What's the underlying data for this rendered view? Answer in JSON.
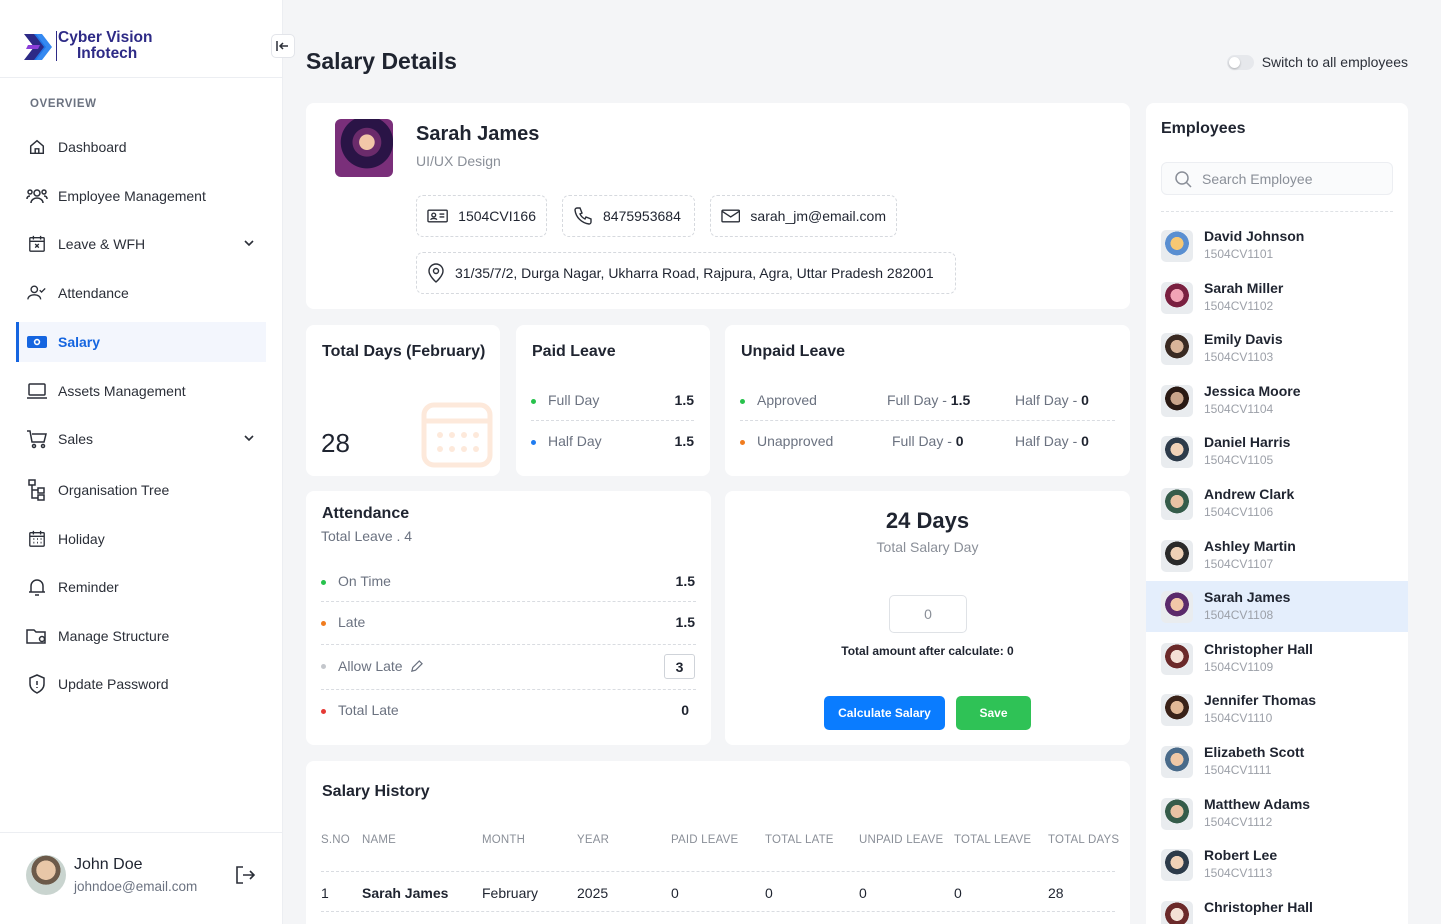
{
  "brand": {
    "line1": "Cyber Vision",
    "line2": "Infotech"
  },
  "sidebar": {
    "section": "OVERVIEW",
    "items": [
      {
        "label": "Dashboard",
        "icon": "home-icon"
      },
      {
        "label": "Employee Management",
        "icon": "users-icon"
      },
      {
        "label": "Leave & WFH",
        "icon": "calendar-x-icon"
      },
      {
        "label": "Attendance",
        "icon": "user-check-icon"
      },
      {
        "label": "Salary",
        "icon": "money-icon"
      },
      {
        "label": "Assets Management",
        "icon": "laptop-icon"
      },
      {
        "label": "Sales",
        "icon": "cart-icon"
      },
      {
        "label": "Organisation Tree",
        "icon": "tree-icon"
      },
      {
        "label": "Holiday",
        "icon": "calendar-icon"
      },
      {
        "label": "Reminder",
        "icon": "bell-icon"
      },
      {
        "label": "Manage Structure",
        "icon": "folder-gear-icon"
      },
      {
        "label": "Update Password",
        "icon": "shield-icon"
      }
    ],
    "active": "Salary"
  },
  "user": {
    "name": "John Doe",
    "email": "johndoe@email.com"
  },
  "header": {
    "title": "Salary Details",
    "switch_label": "Switch to all employees"
  },
  "profile": {
    "name": "Sarah James",
    "role": "UI/UX Design",
    "emp_id": "1504CVI166",
    "phone": "8475953684",
    "email": "sarah_jm@email.com",
    "address": "31/35/7/2, Durga Nagar, Ukharra Road, Rajpura, Agra, Uttar Pradesh 282001"
  },
  "total_days": {
    "title": "Total Days (February)",
    "value": "28"
  },
  "paid_leave": {
    "title": "Paid Leave",
    "full_day_label": "Full Day",
    "full_day": "1.5",
    "half_day_label": "Half Day",
    "half_day": "1.5"
  },
  "unpaid_leave": {
    "title": "Unpaid Leave",
    "approved_label": "Approved",
    "approved_full": "Full Day - ",
    "approved_full_val": "1.5",
    "approved_half": "Half Day - ",
    "approved_half_val": "0",
    "unapproved_label": "Unapproved",
    "unapproved_full": "Full Day - ",
    "unapproved_full_val": "0",
    "unapproved_half": "Half Day - ",
    "unapproved_half_val": "0"
  },
  "attendance": {
    "title": "Attendance",
    "subtitle": "Total Leave . 4",
    "on_time_label": "On Time",
    "on_time": "1.5",
    "late_label": "Late",
    "late": "1.5",
    "allow_late_label": "Allow Late",
    "allow_late": "3",
    "total_late_label": "Total Late",
    "total_late": "0"
  },
  "salary_calc": {
    "days": "24 Days",
    "days_label": "Total Salary Day",
    "input_value": "0",
    "amount_text": "Total amount after calculate: 0",
    "calc_btn": "Calculate Salary",
    "save_btn": "Save"
  },
  "history": {
    "title": "Salary History",
    "columns": [
      "S.NO",
      "NAME",
      "MONTH",
      "YEAR",
      "PAID LEAVE",
      "TOTAL LATE",
      "UNPAID LEAVE",
      "TOTAL LEAVE",
      "TOTAL DAYS"
    ],
    "rows": [
      [
        "1",
        "Sarah James",
        "February",
        "2025",
        "0",
        "0",
        "0",
        "0",
        "28"
      ]
    ]
  },
  "employees": {
    "title": "Employees",
    "search_placeholder": "Search Employee",
    "list": [
      {
        "name": "David Johnson",
        "id": "1504CV1101"
      },
      {
        "name": "Sarah Miller",
        "id": "1504CV1102"
      },
      {
        "name": "Emily Davis",
        "id": "1504CV1103"
      },
      {
        "name": "Jessica Moore",
        "id": "1504CV1104"
      },
      {
        "name": "Daniel Harris",
        "id": "1504CV1105"
      },
      {
        "name": "Andrew Clark",
        "id": "1504CV1106"
      },
      {
        "name": "Ashley Martin",
        "id": "1504CV1107"
      },
      {
        "name": "Sarah James",
        "id": "1504CV1108"
      },
      {
        "name": "Christopher Hall",
        "id": "1504CV1109"
      },
      {
        "name": "Jennifer Thomas",
        "id": "1504CV1110"
      },
      {
        "name": "Elizabeth Scott",
        "id": "1504CV1111"
      },
      {
        "name": "Matthew Adams",
        "id": "1504CV1112"
      },
      {
        "name": "Robert Lee",
        "id": "1504CV1113"
      },
      {
        "name": "Christopher Hall",
        "id": ""
      }
    ],
    "selected": "Sarah James"
  },
  "colors": {
    "accent": "#1565e0",
    "save": "#2fc256",
    "calc": "#0a7cff",
    "green_dot": "#27c24c",
    "blue_dot": "#1f7cf0",
    "orange_dot": "#f07c1f",
    "red_dot": "#e53935",
    "gray_dot": "#c4c7cc"
  }
}
